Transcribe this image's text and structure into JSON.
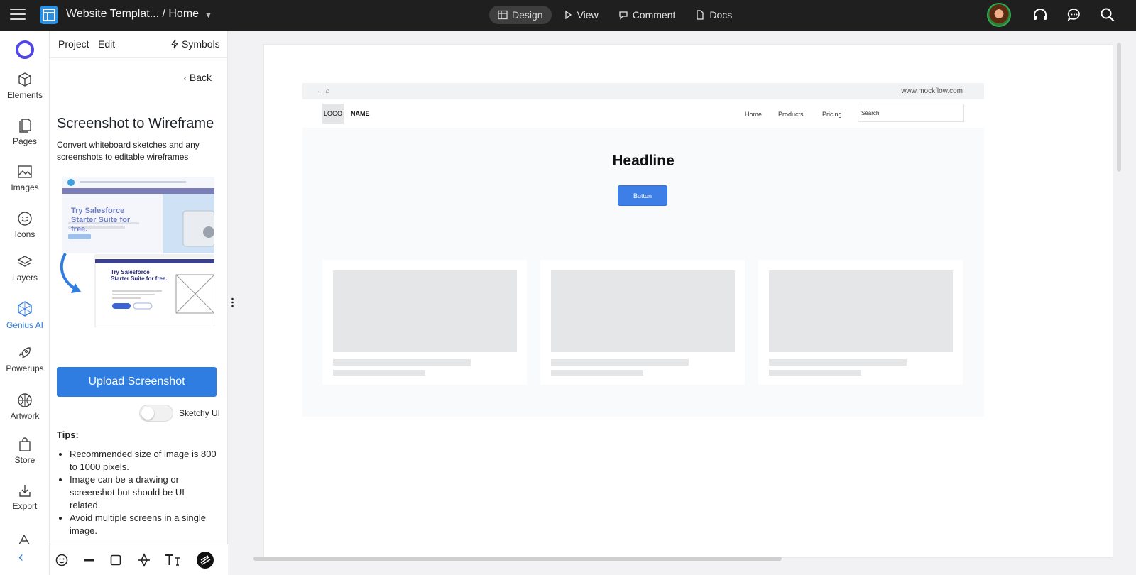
{
  "topbar": {
    "doc_title": "Website Templat... / Home",
    "modes": [
      {
        "label": "Design",
        "active": true
      },
      {
        "label": "View",
        "active": false
      },
      {
        "label": "Comment",
        "active": false
      },
      {
        "label": "Docs",
        "active": false
      }
    ],
    "icons": [
      "menu-icon",
      "app-logo-icon",
      "headset-icon",
      "chat-icon",
      "search-icon"
    ]
  },
  "rail": {
    "items": [
      {
        "label": "Elements",
        "icon": "cube-icon"
      },
      {
        "label": "Pages",
        "icon": "pages-icon"
      },
      {
        "label": "Images",
        "icon": "image-icon"
      },
      {
        "label": "Icons",
        "icon": "smiley-icon"
      },
      {
        "label": "Layers",
        "icon": "layers-icon"
      },
      {
        "label": "Genius AI",
        "icon": "genius-icon",
        "active": true
      },
      {
        "label": "Powerups",
        "icon": "rocket-icon"
      },
      {
        "label": "Artwork",
        "icon": "ball-icon"
      },
      {
        "label": "Store",
        "icon": "bag-icon"
      },
      {
        "label": "Export",
        "icon": "export-icon"
      }
    ],
    "accent": "#2f7de1",
    "brand": "#4f46e5"
  },
  "panel": {
    "tabs": {
      "project": "Project",
      "edit": "Edit",
      "symbols": "Symbols"
    },
    "back": "Back",
    "title": "Screenshot to Wireframe",
    "description": "Convert whiteboard sketches and any screenshots to editable wireframes",
    "preview": {
      "headline_top": "Try Salesforce Starter Suite for free.",
      "headline_bottom": "Try Salesforce Starter Suite for free."
    },
    "upload_label": "Upload Screenshot",
    "toggle_label": "Sketchy UI",
    "toggle_on": false,
    "tips_heading": "Tips:",
    "tips": [
      "Recommended size of image is 800 to 1000 pixels.",
      "Image can be a drawing or screenshot but should be UI related.",
      "Avoid multiple screens in a single image."
    ]
  },
  "bottom_tools": [
    "smiley-tool-icon",
    "line-tool-icon",
    "rect-tool-icon",
    "move-tool-icon",
    "text-tool-icon",
    "sketch-tool-icon"
  ],
  "canvas": {
    "address_bar": {
      "nav": "← ⌂",
      "url": "www.mockflow.com"
    },
    "header": {
      "logo": "LOGO",
      "name": "NAME",
      "nav": [
        "Home",
        "Products",
        "Pricing"
      ],
      "search_placeholder": "Search"
    },
    "headline": "Headline",
    "button": "Button",
    "cards": 3
  }
}
